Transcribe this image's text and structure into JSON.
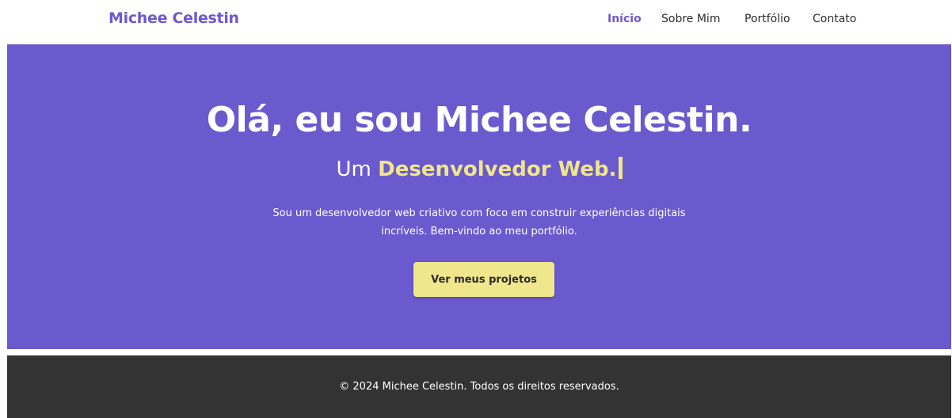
{
  "header": {
    "logo": "Michee Celestin",
    "nav": [
      {
        "label": "Início",
        "active": true
      },
      {
        "label": "Sobre Mim",
        "active": false
      },
      {
        "label": "Portfólio",
        "active": false
      },
      {
        "label": "Contato",
        "active": false
      }
    ]
  },
  "hero": {
    "title": "Olá, eu sou Michee Celestin.",
    "subtitle_prefix": "Um",
    "subtitle_role": "Desenvolvedor Web.",
    "description": "Sou um desenvolvedor web criativo com foco em construir experiências digitais incríveis. Bem-vindo ao meu portfólio.",
    "cta_label": "Ver meus projetos"
  },
  "footer": {
    "copyright": "© 2024 Michee Celestin. Todos os direitos reservados."
  },
  "colors": {
    "accent": "#6a5acd",
    "highlight": "#f0e68c",
    "footer_bg": "#333333",
    "text_dark": "#2b2b2b"
  }
}
